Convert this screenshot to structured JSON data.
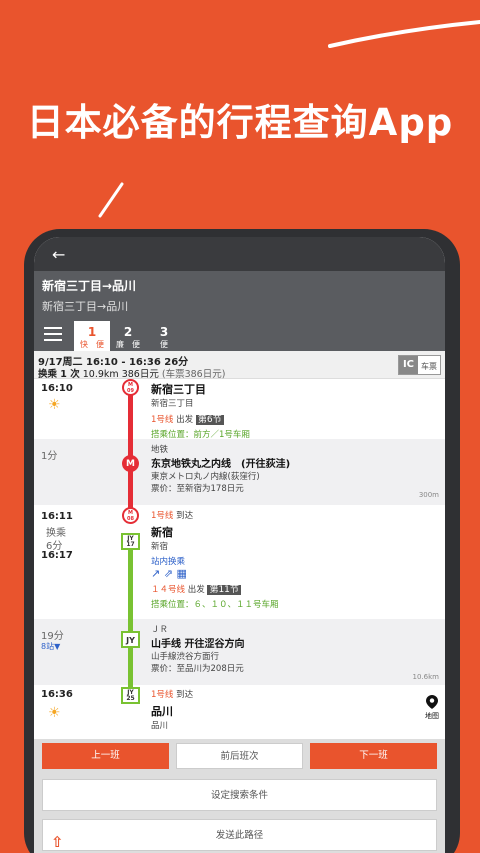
{
  "headline": "日本必备的行程查询App",
  "route": {
    "title": "新宿三丁目→品川",
    "subtitle": "新宿三丁目→品川"
  },
  "tabs": [
    {
      "num": "1",
      "label": "快　便"
    },
    {
      "num": "2",
      "label": "廉　便"
    },
    {
      "num": "3",
      "label": "便"
    }
  ],
  "summary": {
    "line1": "9/17周二 16:10 - 16:36 26分",
    "transfer": "换乘 1 次",
    "details": "10.9km 386日元",
    "fare_note": "(车票386日元)",
    "ic_label": "IC",
    "ticket_label": "车票"
  },
  "steps": {
    "dep_time": "16:10",
    "dep_station": "新宿三丁目",
    "dep_station_reading": "新宿三丁目",
    "dep_platform_line": "1号线",
    "dep_platform_action": "出发",
    "dep_car": "第6节",
    "dep_position": "搭乘位置：前方／1号车厢",
    "ride1_duration": "1分",
    "ride1_operator": "地铁",
    "ride1_line": "东京地铁丸之内线　(开往荻洼)",
    "ride1_line_reading": "東京メトロ丸ノ内線(荻窪行)",
    "ride1_fare": "票价：至新宿为178日元",
    "ride1_distance": "300m",
    "badge_m09": "M\n09",
    "badge_m": "M",
    "badge_m08": "M\n08",
    "xfer_time_arr": "16:11",
    "xfer_label": "换乘",
    "xfer_minutes": "6分",
    "xfer_time_dep": "16:17",
    "xfer_arr_line": "1号线",
    "xfer_arr_action": "到达",
    "xfer_station": "新宿",
    "xfer_station_reading": "新宿",
    "xfer_inside": "站内换乘",
    "xfer_dep_line": "１４号线",
    "xfer_dep_action": "出发",
    "xfer_car": "第11节",
    "xfer_position": "搭乘位置：６、１０、１１号车厢",
    "badge_jy17": "JY\n17",
    "badge_jy": "JY",
    "badge_jy25": "JY\n25",
    "ride2_duration": "19分",
    "ride2_stops": "8站",
    "ride2_operator": "ＪＲ",
    "ride2_line": "山手线 开往涩谷方向",
    "ride2_line_reading": "山手線渋谷方面行",
    "ride2_fare": "票价：至品川为208日元",
    "ride2_distance": "10.6km",
    "arr_time": "16:36",
    "arr_line": "1号线",
    "arr_action": "到达",
    "arr_station": "品川",
    "arr_station_reading": "品川",
    "map_label": "地图"
  },
  "buttons": {
    "prev": "上一班",
    "around": "前后班次",
    "next": "下一班",
    "settings": "设定搜索条件",
    "share": "发送此路径"
  },
  "colors": {
    "accent": "#e9542d",
    "ginza_red": "#e52d36",
    "yamanote_green": "#79c232"
  }
}
